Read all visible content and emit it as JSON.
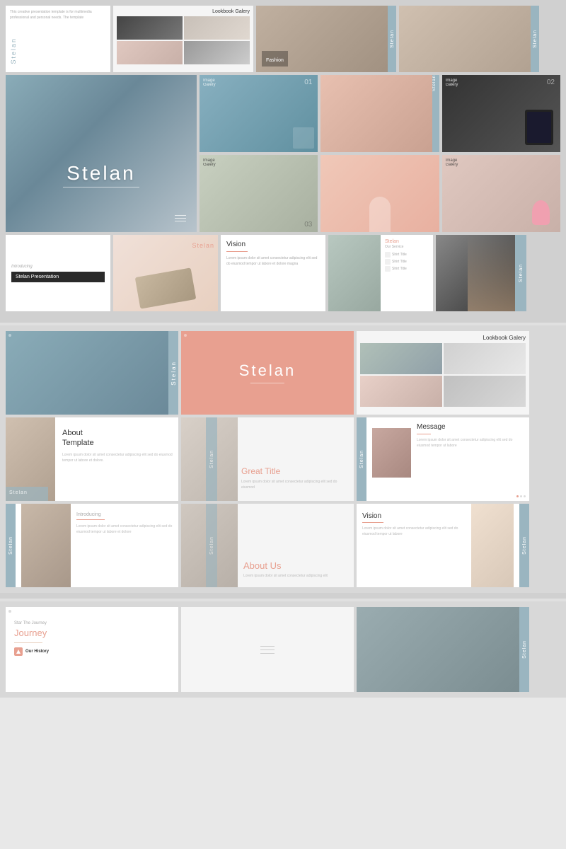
{
  "brand": {
    "name": "Stelan",
    "tagline": "Stelan Presentation"
  },
  "sections": {
    "top": {
      "slides": [
        {
          "id": "s1",
          "type": "intro-text",
          "label": "intro text slide"
        },
        {
          "id": "s2",
          "type": "lookbook",
          "title": "Lookbook Galery"
        },
        {
          "id": "s3",
          "type": "photo-fashion",
          "label": "fashion photo 1"
        },
        {
          "id": "s4",
          "type": "photo-fashion",
          "label": "fashion photo 2"
        }
      ]
    },
    "middle1": {
      "slides": [
        {
          "id": "m1",
          "type": "stelan-main",
          "label": "main stelan slide"
        },
        {
          "id": "m2",
          "type": "image-gallery-1",
          "num": "01",
          "label": "Image Galery"
        },
        {
          "id": "m3",
          "type": "image-gallery-2",
          "num": "02",
          "label": "Image Galery"
        },
        {
          "id": "m4",
          "type": "image-gallery-3",
          "num": "03",
          "label": "Image Galery"
        },
        {
          "id": "m5",
          "type": "image-gallery-4",
          "label": "Image Galery"
        },
        {
          "id": "m6",
          "type": "image-gallery-5",
          "label": "Image Galery"
        }
      ]
    },
    "middle2": {
      "slides": [
        {
          "id": "r1",
          "type": "introducing",
          "sub": "Introducing",
          "title": "Stelan Presentation"
        },
        {
          "id": "r2",
          "type": "stelan-shoes",
          "label": "stelan shoes"
        },
        {
          "id": "r3",
          "type": "vision",
          "title": "Vision",
          "text": "Lorem ipsum dolor sit amet consectetur adipiscing elit sed do eiusmod tempor ut labore et dolore"
        },
        {
          "id": "r4",
          "type": "service",
          "brand": "Stelan",
          "service_title": "Our Service",
          "items": [
            "Shirt Title",
            "Shirt Title",
            "Shirt Title"
          ]
        },
        {
          "id": "r5",
          "type": "dark-fashion",
          "label": "dark fashion side"
        }
      ]
    },
    "large_previews": {
      "row1": [
        {
          "id": "lp1",
          "type": "stelan-photo",
          "brand": "Stelan"
        },
        {
          "id": "lp2",
          "type": "stelan-pink-center",
          "title": "Stelan"
        },
        {
          "id": "lp3",
          "type": "lookbook-galery",
          "title": "Lookbook Galery"
        }
      ],
      "row2": [
        {
          "id": "lp4",
          "type": "about",
          "title": "About Template",
          "text": "Lorem ipsum dolor sit amet consectetur adipiscing elit sed do eiusmod tempor ut labore"
        },
        {
          "id": "lp5",
          "type": "great-title",
          "brand": "Stelan",
          "title": "Great Title",
          "text": "Lorem ipsum dolor sit amet consectetur adipiscing elit"
        },
        {
          "id": "lp6",
          "type": "message",
          "title": "Message",
          "brand": "Stelan",
          "text": "Lorem ipsum dolor sit amet consectetur adipiscing elit sed do eiusmod"
        }
      ],
      "row3": [
        {
          "id": "lp7",
          "type": "introducing-2",
          "sub": "Introducing",
          "brand": "Stelan"
        },
        {
          "id": "lp8",
          "type": "about-us",
          "brand": "Stelan",
          "title": "About Us"
        },
        {
          "id": "lp9",
          "type": "vision-2",
          "brand": "Stelan",
          "title": "Vision",
          "text": "Lorem ipsum dolor sit amet consectetur adipiscing"
        }
      ]
    },
    "bottom": {
      "row1": [
        {
          "id": "bt1",
          "type": "journey",
          "sub": "Star The Journey",
          "title": "Journey",
          "history": "Our History"
        },
        {
          "id": "bt2",
          "type": "menu-slide",
          "label": "menu lines slide"
        },
        {
          "id": "bt3",
          "type": "clothes-photo",
          "label": "clothes hanging photo"
        }
      ]
    }
  }
}
